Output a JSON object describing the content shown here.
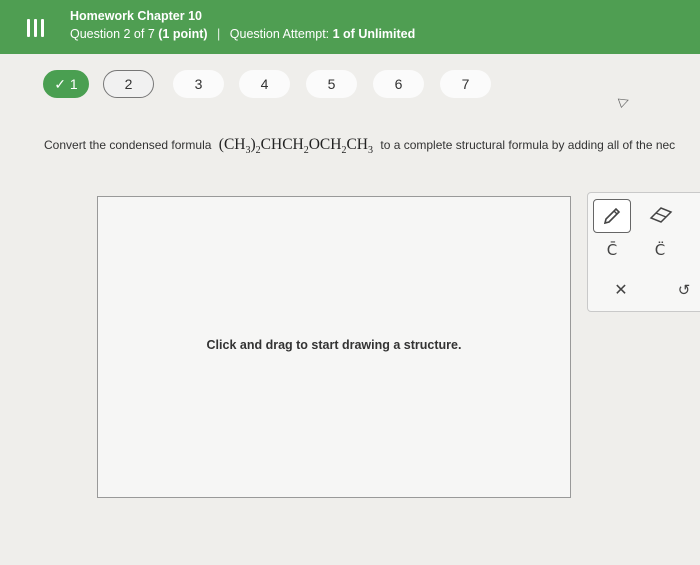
{
  "header": {
    "title": "Homework Chapter 10",
    "question_prefix": "Question 2 of 7",
    "points": "(1 point)",
    "separator": "|",
    "attempt_label": "Question Attempt:",
    "attempt_value": "1 of Unlimited",
    "accent_color": "#4f9e52"
  },
  "nav": {
    "questions": [
      {
        "label": "✓ 1",
        "state": "completed"
      },
      {
        "label": "2",
        "state": "current"
      },
      {
        "label": "3",
        "state": "unvisited"
      },
      {
        "label": "4",
        "state": "unvisited"
      },
      {
        "label": "5",
        "state": "unvisited"
      },
      {
        "label": "6",
        "state": "unvisited"
      },
      {
        "label": "7",
        "state": "unvisited"
      }
    ]
  },
  "prompt": {
    "lead": "Convert the condensed formula",
    "tail": "to a complete structural formula by adding all of the nec"
  },
  "canvas": {
    "hint": "Click and drag to start drawing a structure."
  },
  "tools": {
    "pencil_icon": "pencil-icon",
    "eraser_icon": "eraser-icon",
    "c_anion": "C̄",
    "c_radical": "C̈",
    "close": "✕",
    "undo": "↺"
  }
}
